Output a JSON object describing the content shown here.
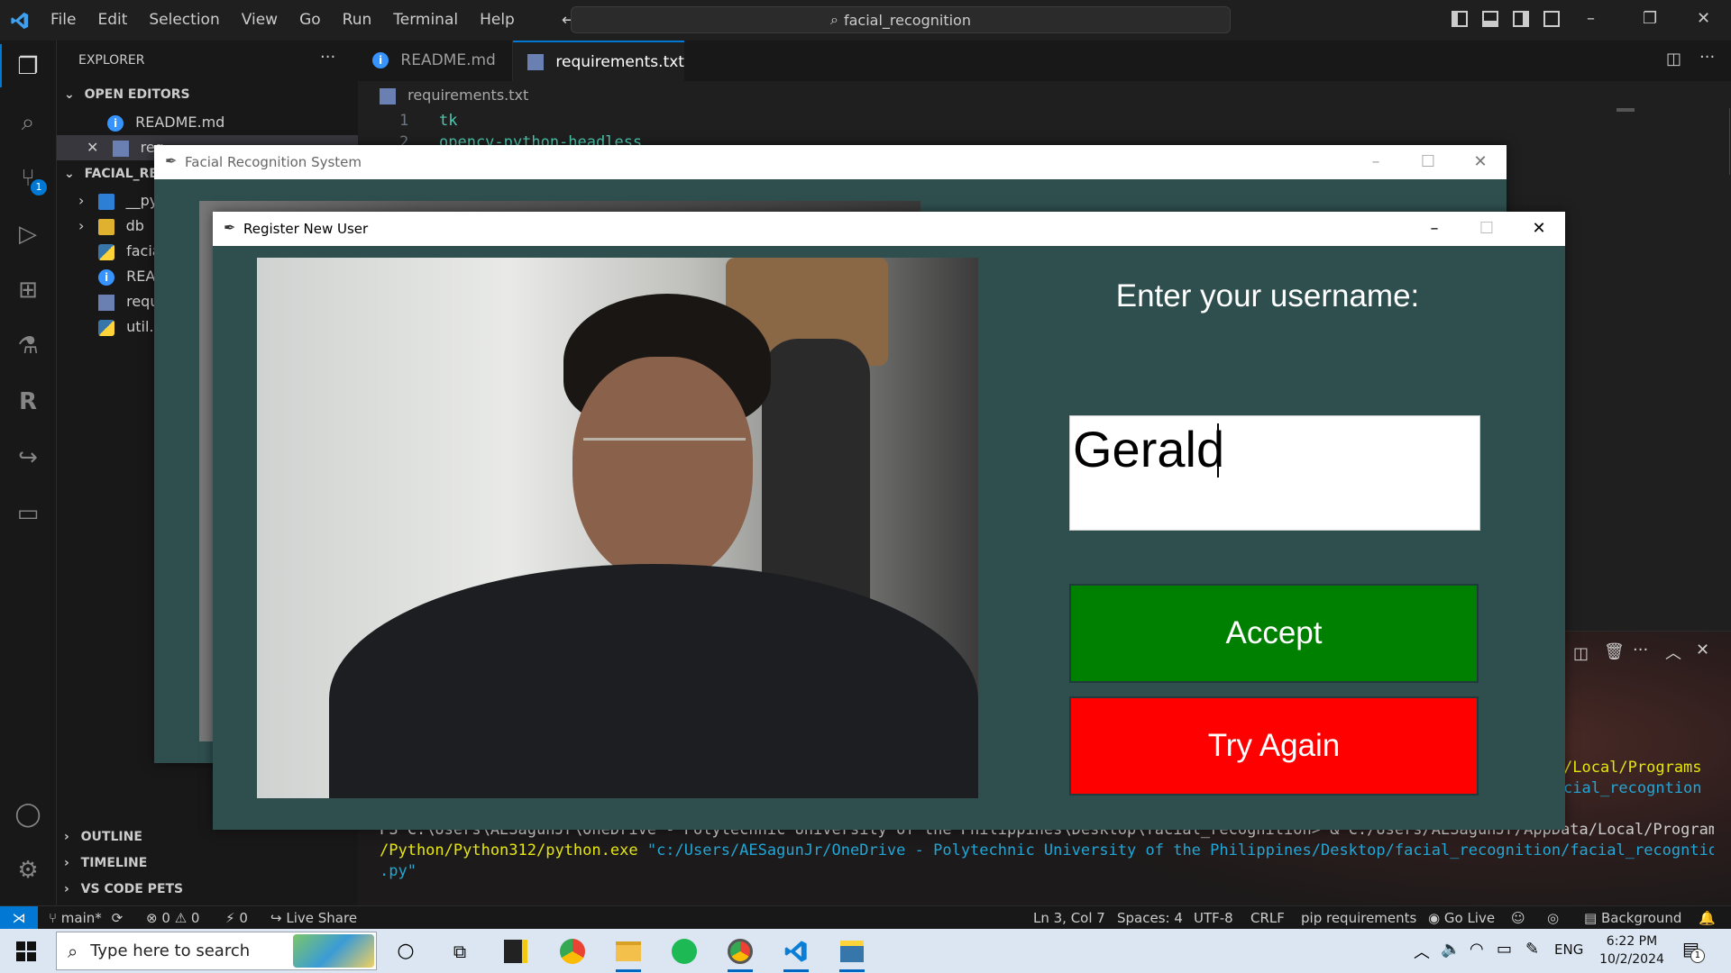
{
  "vscode": {
    "menu": [
      "File",
      "Edit",
      "Selection",
      "View",
      "Go",
      "Run",
      "Terminal",
      "Help"
    ],
    "search_text": "facial_recognition",
    "explorer_title": "EXPLORER",
    "open_editors_title": "OPEN EDITORS",
    "open_editors": [
      {
        "name": "README.md",
        "icon": "info-icon"
      },
      {
        "name": "req",
        "icon": "requirements-file-icon"
      }
    ],
    "workspace_title": "FACIAL_REC",
    "files": [
      {
        "name": "__py",
        "icon": "folder-icon"
      },
      {
        "name": "db",
        "icon": "folder-icon"
      },
      {
        "name": "facia",
        "icon": "python-icon"
      },
      {
        "name": "READ",
        "icon": "info-icon"
      },
      {
        "name": "requ",
        "icon": "requirements-file-icon"
      },
      {
        "name": "util.p",
        "icon": "python-icon"
      }
    ],
    "outline": "OUTLINE",
    "timeline": "TIMELINE",
    "pets": "VS CODE PETS",
    "source_control_badge": "1",
    "tabs": [
      {
        "label": "README.md",
        "active": false
      },
      {
        "label": "requirements.txt",
        "active": true
      }
    ],
    "breadcrumb": "requirements.txt",
    "code_lines": [
      {
        "num": "1",
        "text": "tk"
      },
      {
        "num": "2",
        "text": "opencv-python-headless"
      }
    ],
    "terminal": {
      "line1_right": "/Local/Programs",
      "line2_right": "cial_recogntion",
      "line3": "PS C:\\Users\\AESagunJr\\OneDrive - Polytechnic University of the Philippines\\Desktop\\facial_recognition> & C:/Users/AESagunJr/AppData/Local/Programs",
      "line4_a": "/Python/Python312/python.exe",
      "line4_b": "\"c:/Users/AESagunJr/OneDrive - Polytechnic University of the Philippines/Desktop/facial_recognition/facial_recogntion",
      "line5": ".py\""
    },
    "status": {
      "branch": "main*",
      "errors": "0",
      "warnings": "0",
      "ports": "0",
      "live_share": "Live Share",
      "position": "Ln 3, Col 7",
      "spaces": "Spaces: 4",
      "encoding": "UTF-8",
      "eol": "CRLF",
      "language": "pip requirements",
      "go_live": "Go Live",
      "background": "Background"
    }
  },
  "app_main": {
    "title": "Facial Recognition System"
  },
  "register": {
    "title": "Register New User",
    "prompt": "Enter your username:",
    "username_value": "Gerald",
    "accept_label": "Accept",
    "try_again_label": "Try Again"
  },
  "taskbar": {
    "search_placeholder": "Type here to search",
    "language": "ENG",
    "time": "6:22 PM",
    "date": "10/2/2024",
    "notification_count": "1"
  },
  "colors": {
    "tk_bg": "#2f4f4f",
    "accept": "#008000",
    "try_again": "#ff0000",
    "vscode_accent": "#0078d4"
  }
}
